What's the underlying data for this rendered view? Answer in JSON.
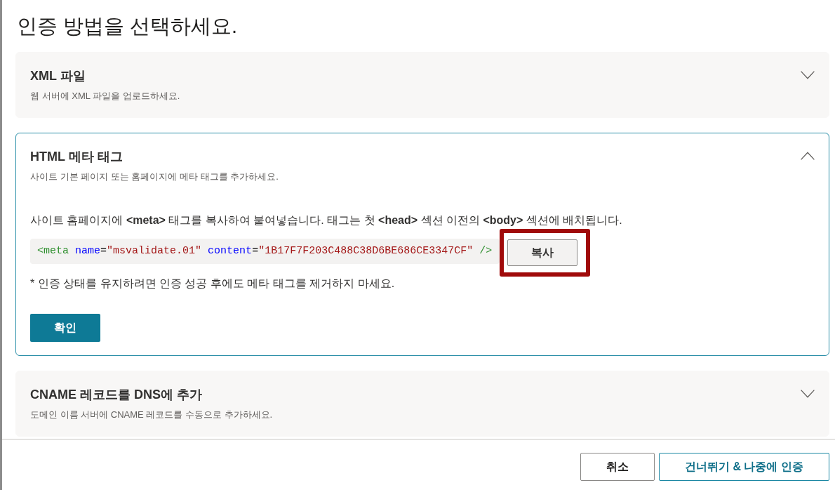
{
  "dialog": {
    "title": "인증 방법을 선택하세요."
  },
  "methods": [
    {
      "title": "XML 파일",
      "description": "웹 서버에 XML 파일을 업로드하세요.",
      "expanded": false
    },
    {
      "title": "HTML 메타 태그",
      "description": "사이트 기본 페이지 또는 홈페이지에 메타 태그를 추가하세요.",
      "expanded": true,
      "instruction": "사이트 홈페이지에 **<meta>** 태그를 복사하여 붙여넣습니다. 태그는 첫 **<head>** 섹션 이전의 **<body>** 섹션에 배치됩니다.",
      "code": [
        {
          "kind": "tag",
          "text": "<meta"
        },
        {
          "kind": "attr",
          "text": "name"
        },
        {
          "kind": "punct",
          "text": "="
        },
        {
          "kind": "value",
          "text": "\"msvalidate.01\""
        },
        {
          "kind": "attr",
          "text": "content"
        },
        {
          "kind": "punct",
          "text": "="
        },
        {
          "kind": "value",
          "text": "\"1B17F7F203C488C38D6BE686CE3347CF\""
        },
        {
          "kind": "tag",
          "text": "/>"
        }
      ],
      "copy_button": {
        "label": "복사",
        "highlighted": true
      },
      "note": "* 인증 상태를 유지하려면 인증 성공 후에도 메타 태그를 제거하지 마세요.",
      "confirm_button": "확인"
    },
    {
      "title": "CNAME 레코드를 DNS에 추가",
      "description": "도메인 이름 서버에 CNAME 레코드를 수동으로 추가하세요.",
      "expanded": false
    }
  ],
  "footer_buttons": [
    {
      "label": "취소",
      "kind": "secondary"
    },
    {
      "label": "건너뛰기 & 나중에 인증",
      "kind": "outline"
    }
  ]
}
